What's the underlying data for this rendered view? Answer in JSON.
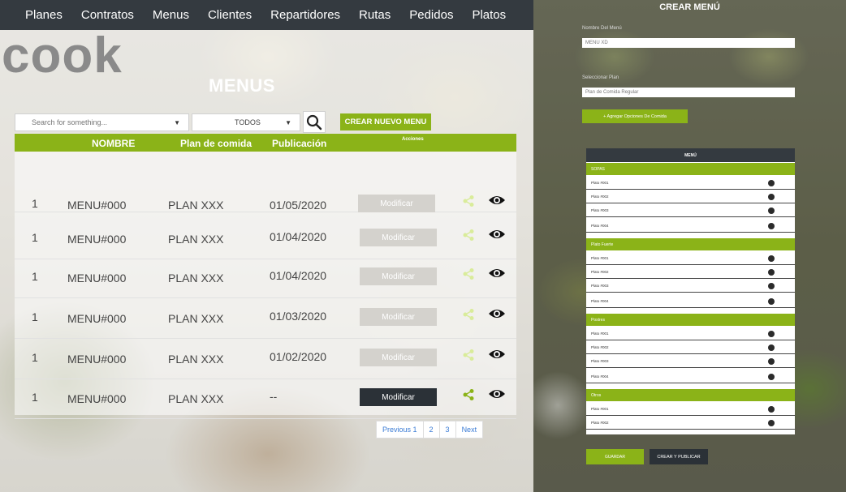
{
  "nav": {
    "items": [
      "Planes",
      "Contratos",
      "Menus",
      "Clientes",
      "Repartidores",
      "Rutas",
      "Pedidos",
      "Platos"
    ]
  },
  "logo": {
    "text": "cook"
  },
  "page": {
    "title": "MENUS"
  },
  "toolbar": {
    "search_placeholder": "Search for something...",
    "filter_value": "TODOS",
    "new_menu_label": "CREAR NUEVO MENU"
  },
  "table": {
    "headers": {
      "nombre": "NOMBRE",
      "plan": "Plan de comida",
      "publicacion": "Publicación",
      "acciones": "Acciones"
    },
    "rows": [
      {
        "num": "1",
        "nombre": "MENU#000",
        "plan": "PLAN XXX",
        "fecha": "01/05/2020",
        "action": "Modificar",
        "enabled": false
      },
      {
        "num": "1",
        "nombre": "MENU#000",
        "plan": "PLAN XXX",
        "fecha": "01/04/2020",
        "action": "Modificar",
        "enabled": false
      },
      {
        "num": "1",
        "nombre": "MENU#000",
        "plan": "PLAN XXX",
        "fecha": "01/04/2020",
        "action": "Modificar",
        "enabled": false
      },
      {
        "num": "1",
        "nombre": "MENU#000",
        "plan": "PLAN XXX",
        "fecha": "01/03/2020",
        "action": "Modificar",
        "enabled": false
      },
      {
        "num": "1",
        "nombre": "MENU#000",
        "plan": "PLAN XXX",
        "fecha": "01/02/2020",
        "action": "Modificar",
        "enabled": false
      },
      {
        "num": "1",
        "nombre": "MENU#000",
        "plan": "PLAN XXX",
        "fecha": "--",
        "action": "Modificar",
        "enabled": true
      }
    ]
  },
  "pagination": {
    "previous": "Previous 1",
    "page2": "2",
    "page3": "3",
    "next": "Next"
  },
  "crear": {
    "title": "CREAR MENÚ",
    "name_label": "Nombre Del Menú",
    "name_value": "MENU XD",
    "plan_label": "Seleccionar Plan",
    "plan_value": "Plan de Comida Regular",
    "add_label": "+ Agregar Opciones De Comida",
    "list_header": "MENÚ",
    "sections": [
      {
        "title": "SOPAS",
        "items": [
          "Plato #001",
          "Plato #002",
          "Plato #003",
          "Plato #004"
        ]
      },
      {
        "title": "Plato Fuerte",
        "items": [
          "Plato #001",
          "Plato #002",
          "Plato #003",
          "Plato #004"
        ]
      },
      {
        "title": "Postres",
        "items": [
          "Plato #001",
          "Plato #002",
          "Plato #003",
          "Plato #004"
        ]
      },
      {
        "title": "Otros",
        "items": [
          "Plato #001",
          "Plato #002"
        ]
      }
    ],
    "save_label": "GUARDAR",
    "publish_label": "CREAR Y PUBLICAR"
  },
  "colors": {
    "accent": "#8bb318",
    "dark": "#343a40",
    "share": "#9ccc2a"
  }
}
